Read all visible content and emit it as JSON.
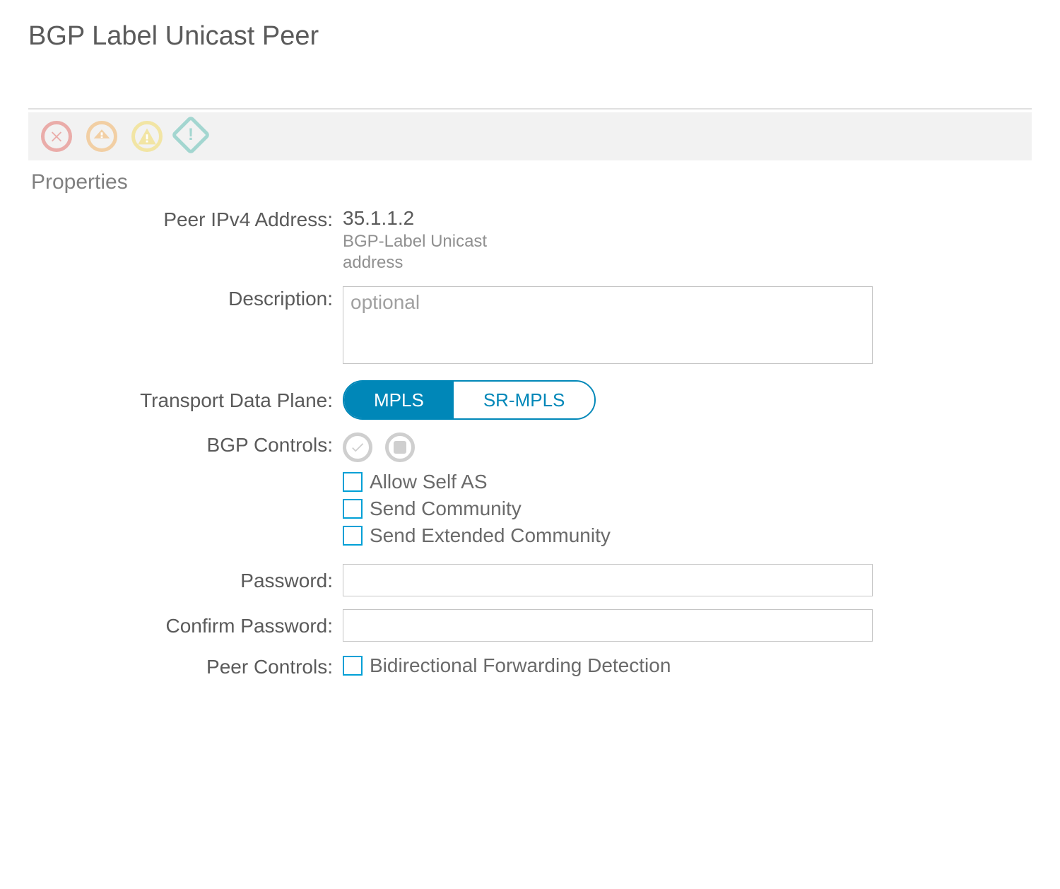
{
  "title": "BGP Label Unicast Peer",
  "section": {
    "title": "Properties",
    "fields": {
      "peer_ipv4": {
        "label": "Peer IPv4 Address:",
        "value": "35.1.1.2",
        "hint": "BGP-Label Unicast address"
      },
      "description": {
        "label": "Description:",
        "placeholder": "optional",
        "value": ""
      },
      "transport": {
        "label": "Transport Data Plane:",
        "options": {
          "mpls": "MPLS",
          "sr_mpls": "SR-MPLS"
        }
      },
      "bgp_controls": {
        "label": "BGP Controls:",
        "allow_self_as": "Allow Self AS",
        "send_community": "Send Community",
        "send_ext_community": "Send Extended Community"
      },
      "password": {
        "label": "Password:"
      },
      "confirm_password": {
        "label": "Confirm Password:"
      },
      "peer_controls": {
        "label": "Peer Controls:",
        "bfd": "Bidirectional Forwarding Detection"
      }
    }
  }
}
